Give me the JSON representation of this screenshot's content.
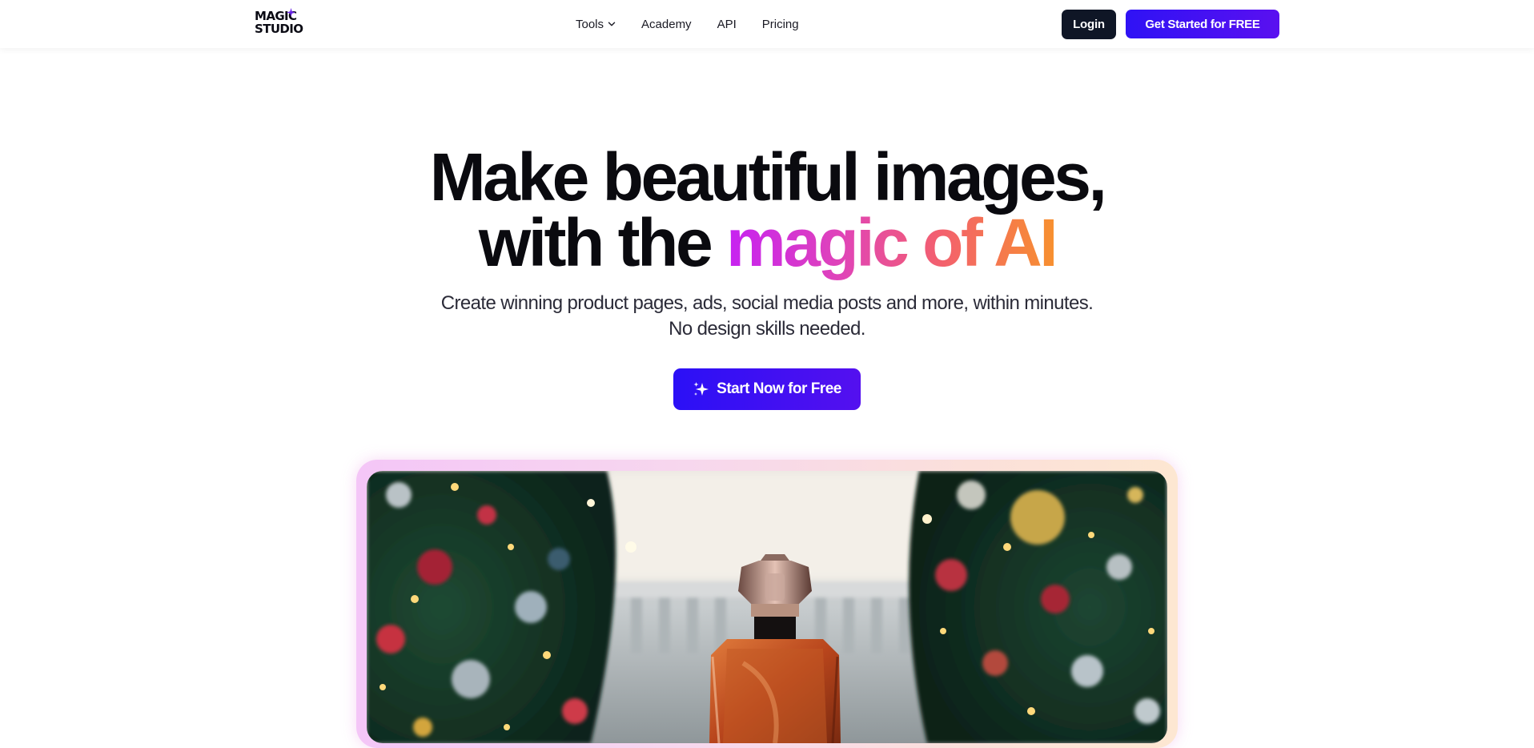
{
  "header": {
    "logo": {
      "line1": "MAGIC",
      "line2": "STUDIO"
    },
    "nav": [
      {
        "label": "Tools",
        "has_dropdown": true
      },
      {
        "label": "Academy"
      },
      {
        "label": "API"
      },
      {
        "label": "Pricing"
      }
    ],
    "login_label": "Login",
    "cta_label": "Get Started for FREE"
  },
  "hero": {
    "headline_line1": "Make beautiful images,",
    "headline_line2_plain": "with the ",
    "headline_line2_gradient": "magic of AI",
    "subtitle_line1": "Create winning product pages, ads, social media posts and more, within minutes.",
    "subtitle_line2": "No design skills needed.",
    "start_button_label": "Start Now for Free"
  },
  "preview": {
    "image": "perfume-bottle-christmas-tree-bokeh"
  },
  "colors": {
    "brand_blue": "#2f12f5",
    "brand_purple": "#5a10f0",
    "login_bg": "#0f1626",
    "gradient_stops": [
      "#c622f2",
      "#e044b8",
      "#f3606e",
      "#f7902f"
    ]
  },
  "icons": {
    "logo_spark": "sparkle-icon",
    "tools_dropdown": "chevron-down-icon",
    "start_button": "sparkles-icon"
  }
}
